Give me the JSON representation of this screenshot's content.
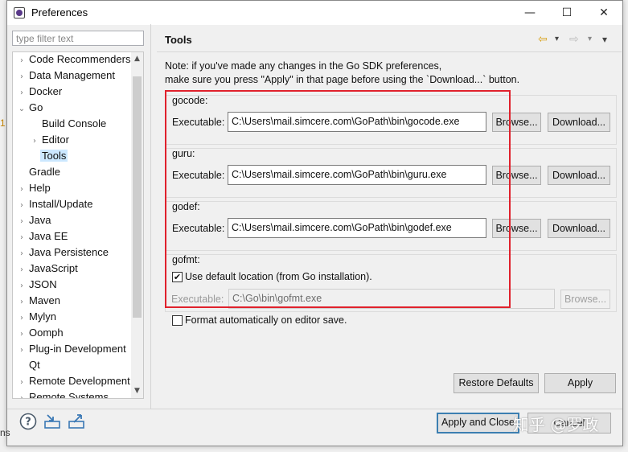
{
  "window": {
    "title": "Preferences"
  },
  "titlebar_controls": {
    "minimize": "—",
    "maximize": "☐",
    "close": "✕"
  },
  "filter": {
    "placeholder": "type filter text"
  },
  "tree": {
    "items": [
      {
        "label": "Code Recommenders",
        "expander": "›"
      },
      {
        "label": "Data Management",
        "expander": "›"
      },
      {
        "label": "Docker",
        "expander": "›"
      },
      {
        "label": "Go",
        "expander": "⌄"
      },
      {
        "label": "Build Console",
        "expander": ""
      },
      {
        "label": "Editor",
        "expander": "›"
      },
      {
        "label": "Tools",
        "expander": ""
      },
      {
        "label": "Gradle",
        "expander": ""
      },
      {
        "label": "Help",
        "expander": "›"
      },
      {
        "label": "Install/Update",
        "expander": "›"
      },
      {
        "label": "Java",
        "expander": "›"
      },
      {
        "label": "Java EE",
        "expander": "›"
      },
      {
        "label": "Java Persistence",
        "expander": "›"
      },
      {
        "label": "JavaScript",
        "expander": "›"
      },
      {
        "label": "JSON",
        "expander": "›"
      },
      {
        "label": "Maven",
        "expander": "›"
      },
      {
        "label": "Mylyn",
        "expander": "›"
      },
      {
        "label": "Oomph",
        "expander": "›"
      },
      {
        "label": "Plug-in Development",
        "expander": "›"
      },
      {
        "label": "Qt",
        "expander": ""
      },
      {
        "label": "Remote Development",
        "expander": "›"
      },
      {
        "label": "Remote Systems",
        "expander": "›"
      }
    ],
    "scroll_up": "▲",
    "scroll_down": "▼"
  },
  "page": {
    "title": "Tools",
    "nav": {
      "back": "⇦",
      "back_menu": "▾",
      "forward": "⇨",
      "forward_menu": "▾",
      "menu": "▾"
    },
    "note_line1": "Note: if you've made any changes in the Go SDK preferences,",
    "note_line2": "make sure you press \"Apply\" in that page before using the `Download...` button."
  },
  "gocode": {
    "label": "gocode:",
    "exec_label": "Executable:",
    "path": "C:\\Users\\mail.simcere.com\\GoPath\\bin\\gocode.exe",
    "browse": "Browse...",
    "download": "Download..."
  },
  "guru": {
    "label": "guru:",
    "exec_label": "Executable:",
    "path": "C:\\Users\\mail.simcere.com\\GoPath\\bin\\guru.exe",
    "browse": "Browse...",
    "download": "Download..."
  },
  "godef": {
    "label": "godef:",
    "exec_label": "Executable:",
    "path": "C:\\Users\\mail.simcere.com\\GoPath\\bin\\godef.exe",
    "browse": "Browse...",
    "download": "Download..."
  },
  "gofmt": {
    "label": "gofmt:",
    "use_default": "Use default location (from Go installation).",
    "use_default_checked": true,
    "exec_label": "Executable:",
    "path": "C:\\Go\\bin\\gofmt.exe",
    "browse": "Browse..."
  },
  "format_on_save": {
    "label": "Format automatically on editor save.",
    "checked": false
  },
  "buttons": {
    "restore_defaults": "Restore Defaults",
    "apply": "Apply",
    "apply_and_close": "Apply and Close",
    "cancel": "Cancel"
  },
  "watermark": "知乎 @罗政",
  "edge_fragments": {
    "left_top": "1",
    "left_bottom": "ns"
  },
  "colors": {
    "highlight_box": "#e0212c",
    "selection": "#cce8ff"
  }
}
